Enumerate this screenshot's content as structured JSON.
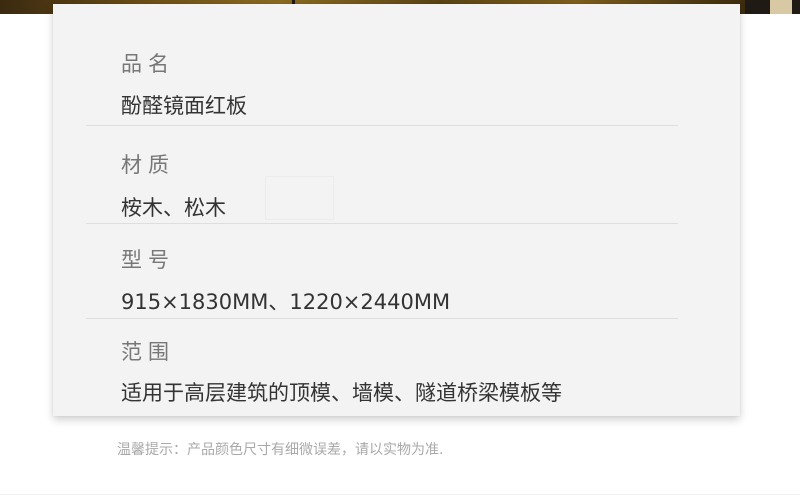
{
  "specs": [
    {
      "label": "品名",
      "value": "酚醛镜面红板"
    },
    {
      "label": "材质",
      "value": "桉木、松木"
    },
    {
      "label": "型号",
      "value": "915×1830MM、1220×2440MM"
    },
    {
      "label": "范围",
      "value": "适用于高层建筑的顶模、墙模、隧道桥梁模板等"
    }
  ],
  "footnote": "温馨提示：产品颜色尺寸有细微误差，请以实物为准.",
  "colors": {
    "card_background": "#f3f3f3",
    "label_text": "#777777",
    "value_text": "#333333",
    "footnote_text": "#a9a9a9"
  }
}
